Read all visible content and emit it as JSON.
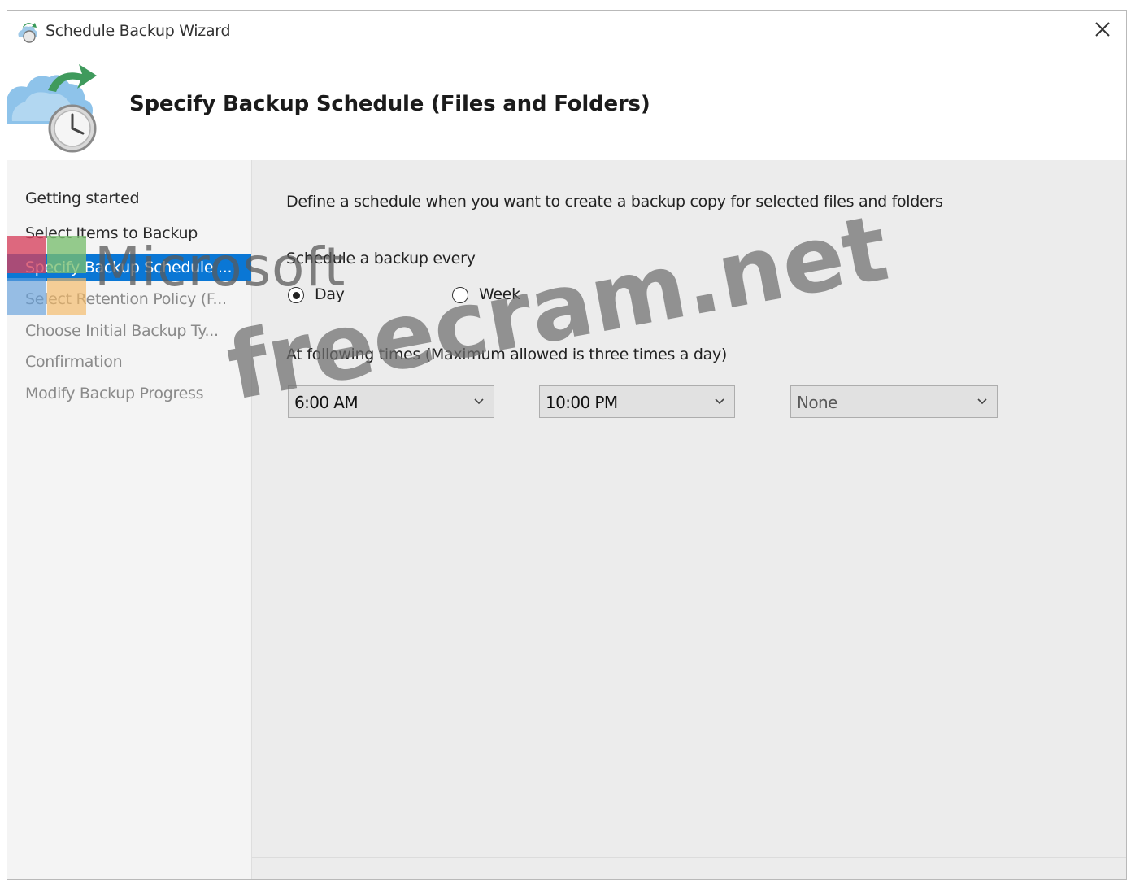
{
  "window": {
    "title": "Schedule Backup Wizard"
  },
  "header": {
    "title": "Specify Backup Schedule (Files and Folders)"
  },
  "sidebar": {
    "items": [
      {
        "label": "Getting started",
        "state": "done"
      },
      {
        "label": "Select Items to Backup",
        "state": "done"
      },
      {
        "label": "Specify Backup Schedule ...",
        "state": "active"
      },
      {
        "label": "Select Retention Policy (F...",
        "state": "pending"
      },
      {
        "label": "Choose Initial Backup Ty...",
        "state": "pending"
      },
      {
        "label": "Confirmation",
        "state": "pending"
      },
      {
        "label": "Modify Backup Progress",
        "state": "pending"
      }
    ]
  },
  "main": {
    "description": "Define a schedule when you want to create a backup copy for selected files and folders",
    "schedule_label": "Schedule a backup every",
    "radio_day": {
      "label": "Day",
      "checked": true
    },
    "radio_week": {
      "label": "Week",
      "checked": false
    },
    "times_label": "At following times (Maximum allowed is three times a day)",
    "time1": "6:00 AM",
    "time2": "10:00 PM",
    "time3": "None"
  },
  "watermarks": {
    "site": "freecram.net",
    "brand": "Microsoft"
  },
  "colors": {
    "selection": "#0a77d5",
    "content_bg": "#ececec",
    "sidebar_bg": "#f4f4f4"
  }
}
